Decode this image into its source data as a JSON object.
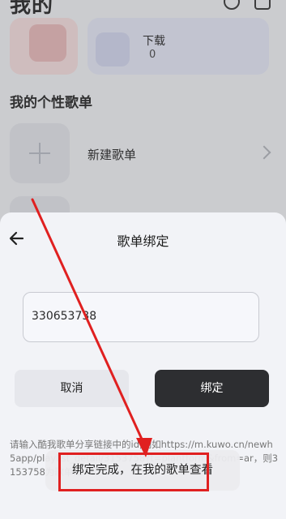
{
  "background": {
    "header_title": "我的",
    "download": {
      "label": "下载",
      "count": "0"
    },
    "section_title": "我的个性歌单",
    "new_playlist_label": "新建歌单"
  },
  "sheet": {
    "title": "歌单绑定",
    "input_value": "330653738",
    "cancel_label": "取消",
    "bind_label": "绑定",
    "hint": "请输入酷我歌单分享链接中的id,例如https://m.kuwo.cn/newh5app/playlist_detail/3153758?t=plantform&from=ar，则3153758为歌单id"
  },
  "toast": {
    "text": "绑定完成，在我的歌单查看"
  },
  "colors": {
    "annotation": "#e02020",
    "bind_button": "#2d2e31"
  }
}
